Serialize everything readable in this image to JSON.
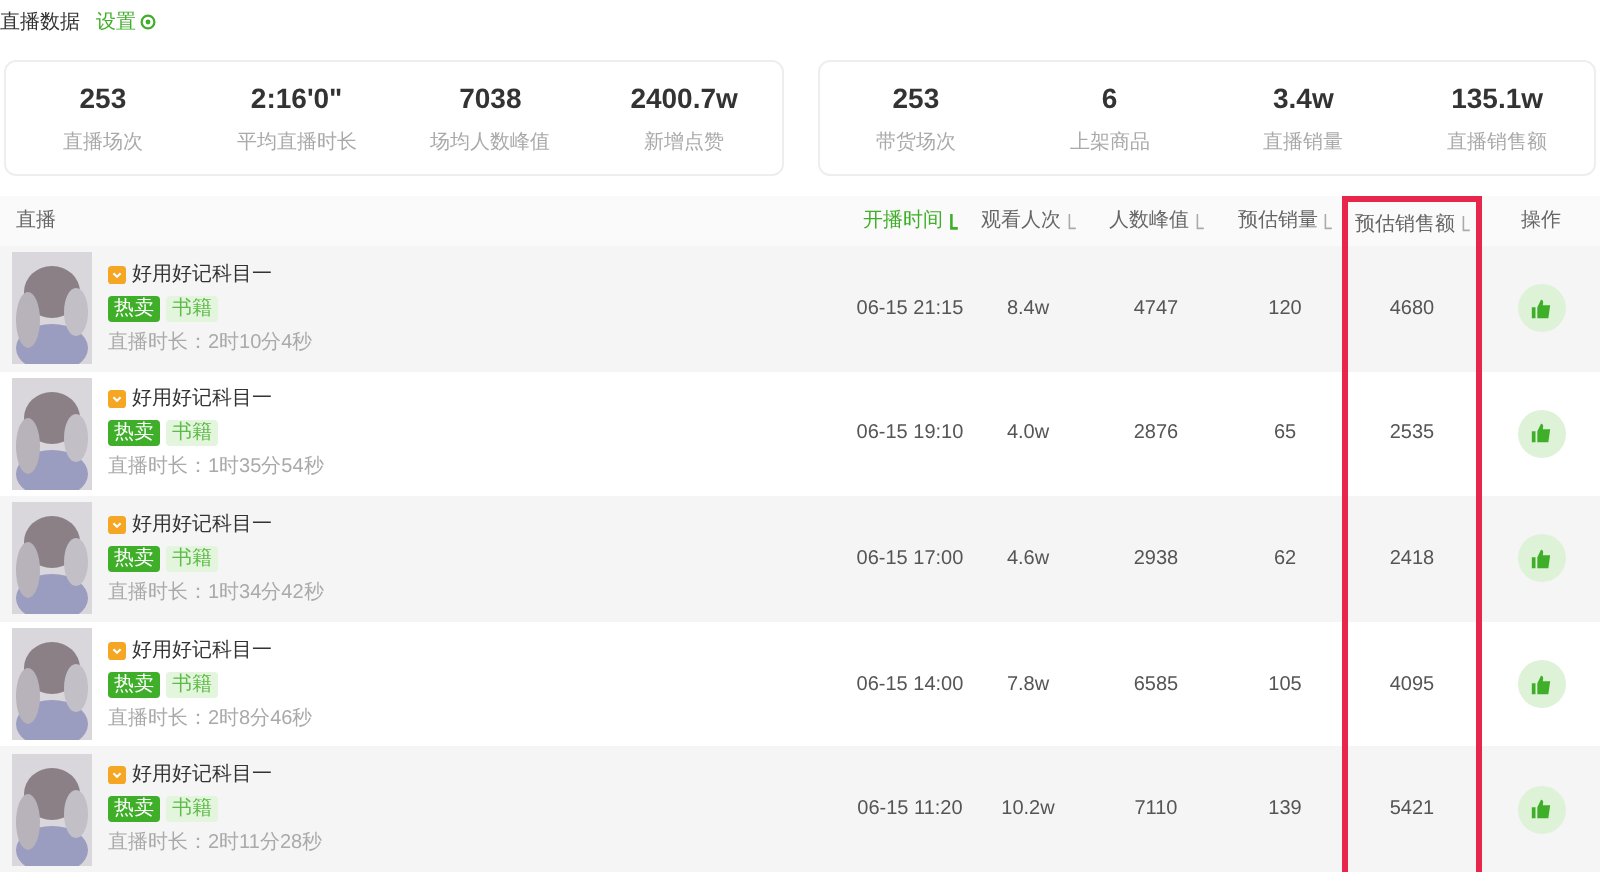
{
  "header": {
    "title": "直播数据",
    "settings_link": "设置"
  },
  "stat_groups": [
    {
      "stats": [
        {
          "value": "253",
          "label": "直播场次"
        },
        {
          "value": "2:16'0\"",
          "label": "平均直播时长"
        },
        {
          "value": "7038",
          "label": "场均人数峰值"
        },
        {
          "value": "2400.7w",
          "label": "新增点赞"
        }
      ]
    },
    {
      "stats": [
        {
          "value": "253",
          "label": "带货场次"
        },
        {
          "value": "6",
          "label": "上架商品"
        },
        {
          "value": "3.4w",
          "label": "直播销量"
        },
        {
          "value": "135.1w",
          "label": "直播销售额"
        }
      ]
    }
  ],
  "table": {
    "columns": [
      {
        "label": "直播",
        "sortable": false,
        "selected": false,
        "highlighted": false
      },
      {
        "label": "开播时间",
        "sortable": true,
        "selected": true,
        "highlighted": false
      },
      {
        "label": "观看人次",
        "sortable": true,
        "selected": false,
        "highlighted": false
      },
      {
        "label": "人数峰值",
        "sortable": true,
        "selected": false,
        "highlighted": false
      },
      {
        "label": "预估销量",
        "sortable": true,
        "selected": false,
        "highlighted": false
      },
      {
        "label": "预估销售额",
        "sortable": true,
        "selected": false,
        "highlighted": true
      },
      {
        "label": "操作",
        "sortable": false,
        "selected": false,
        "highlighted": false
      }
    ],
    "rows": [
      {
        "title": "好用好记科目一",
        "tags": [
          "热卖",
          "书籍"
        ],
        "duration": "直播时长：2时10分4秒",
        "start": "06-15 21:15",
        "views": "8.4w",
        "peak": "4747",
        "sales": "120",
        "revenue": "4680"
      },
      {
        "title": "好用好记科目一",
        "tags": [
          "热卖",
          "书籍"
        ],
        "duration": "直播时长：1时35分54秒",
        "start": "06-15 19:10",
        "views": "4.0w",
        "peak": "2876",
        "sales": "65",
        "revenue": "2535"
      },
      {
        "title": "好用好记科目一",
        "tags": [
          "热卖",
          "书籍"
        ],
        "duration": "直播时长：1时34分42秒",
        "start": "06-15 17:00",
        "views": "4.6w",
        "peak": "2938",
        "sales": "62",
        "revenue": "2418"
      },
      {
        "title": "好用好记科目一",
        "tags": [
          "热卖",
          "书籍"
        ],
        "duration": "直播时长：2时8分46秒",
        "start": "06-15 14:00",
        "views": "7.8w",
        "peak": "6585",
        "sales": "105",
        "revenue": "4095"
      },
      {
        "title": "好用好记科目一",
        "tags": [
          "热卖",
          "书籍"
        ],
        "duration": "直播时长：2时11分28秒",
        "start": "06-15 11:20",
        "views": "10.2w",
        "peak": "7110",
        "sales": "139",
        "revenue": "5421"
      }
    ]
  }
}
